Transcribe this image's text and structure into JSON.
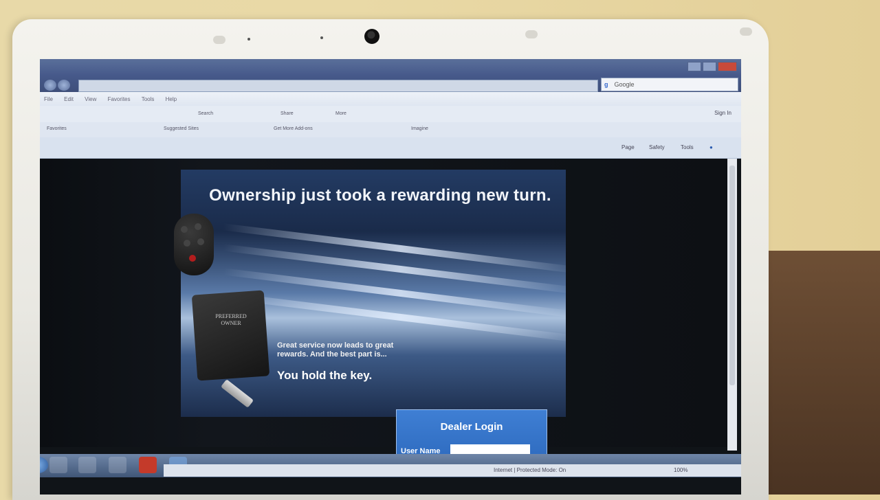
{
  "browser": {
    "search_placeholder": "Google",
    "sign_in": "Sign In",
    "menu": [
      "File",
      "Edit",
      "View",
      "Favorites",
      "Tools",
      "Help"
    ],
    "toolbar_items": [
      "Search",
      "Share",
      "More"
    ],
    "favorites": [
      "Favorites",
      "Suggested Sites",
      "Get More Add-ons",
      "Imagine"
    ],
    "command_items": [
      "Page",
      "Safety",
      "Tools"
    ]
  },
  "page": {
    "headline": "Ownership just took a rewarding new turn.",
    "tag_text": "PREFERRED OWNER",
    "body_line1": "Great service now leads to great rewards. And the best part is...",
    "body_line2": "You hold the key.",
    "login_title": "Dealer Login",
    "login_username_label": "User Name"
  },
  "status": {
    "zone": "Internet | Protected Mode: On",
    "zoom": "100%"
  },
  "colors": {
    "login_bg": "#3f7fd4",
    "titlebar": "#46598a",
    "close_button": "#c84a3a"
  }
}
